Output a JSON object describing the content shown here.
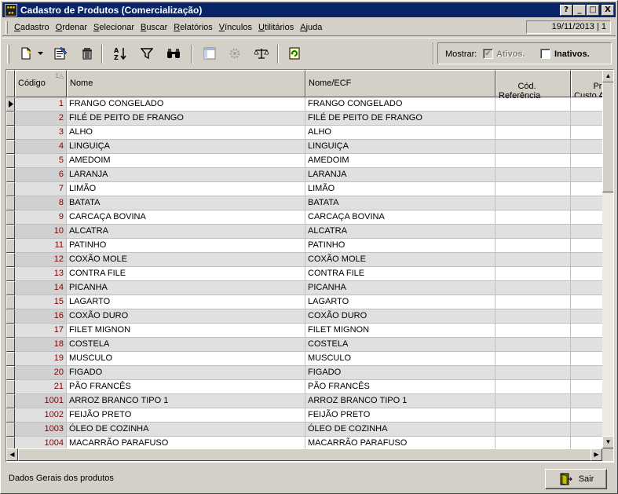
{
  "window": {
    "title": "Cadastro de Produtos (Comercialização)",
    "icon_name": "app-icon",
    "buttons": [
      "?",
      "_",
      "□",
      "X"
    ]
  },
  "menu": {
    "items": [
      {
        "label": "Cadastro",
        "hotkey": "C",
        "rest": "adastro"
      },
      {
        "label": "Ordenar",
        "hotkey": "O",
        "rest": "rdenar"
      },
      {
        "label": "Selecionar",
        "hotkey": "S",
        "rest": "elecionar"
      },
      {
        "label": "Buscar",
        "hotkey": "B",
        "rest": "uscar"
      },
      {
        "label": "Relatórios",
        "hotkey": "R",
        "rest": "elatórios"
      },
      {
        "label": "Vínculos",
        "hotkey": "V",
        "rest": "ínculos"
      },
      {
        "label": "Utilitários",
        "hotkey": "U",
        "rest": "tilitários"
      },
      {
        "label": "Ajuda",
        "hotkey": "A",
        "rest": "juda"
      }
    ],
    "date": "19/11/2013 | 1"
  },
  "toolbar": {
    "icons": [
      "new-record-icon",
      "dropdown-arrow-icon",
      "edit-record-icon",
      "delete-icon",
      "sort-az-icon",
      "filter-icon",
      "binoculars-icon",
      "layout-icon",
      "gear-icon",
      "balance-icon",
      "refresh-icon"
    ],
    "mostrar_label": "Mostrar:",
    "ativos_label": "Ativos.",
    "ativos_checked": true,
    "ativos_disabled": true,
    "inativos_label": "Inativos.",
    "inativos_checked": false
  },
  "grid": {
    "columns": [
      {
        "label": "Código",
        "sort_indicator": "1△"
      },
      {
        "label": "Nome"
      },
      {
        "label": "Nome/ECF"
      },
      {
        "label": "Cód.\nReferência"
      },
      {
        "label": "Preço d\nCusto A"
      }
    ],
    "rows": [
      {
        "codigo": "1",
        "nome": "FRANGO CONGELADO",
        "ecf": "FRANGO CONGELADO"
      },
      {
        "codigo": "2",
        "nome": "FILÉ DE PEITO DE FRANGO",
        "ecf": "FILÉ DE PEITO DE FRANGO"
      },
      {
        "codigo": "3",
        "nome": "ALHO",
        "ecf": "ALHO"
      },
      {
        "codigo": "4",
        "nome": "LINGUIÇA",
        "ecf": "LINGUIÇA"
      },
      {
        "codigo": "5",
        "nome": "AMEDOIM",
        "ecf": "AMEDOIM"
      },
      {
        "codigo": "6",
        "nome": "LARANJA",
        "ecf": "LARANJA"
      },
      {
        "codigo": "7",
        "nome": "LIMÃO",
        "ecf": "LIMÃO"
      },
      {
        "codigo": "8",
        "nome": "BATATA",
        "ecf": "BATATA"
      },
      {
        "codigo": "9",
        "nome": "CARCAÇA BOVINA",
        "ecf": "CARCAÇA BOVINA"
      },
      {
        "codigo": "10",
        "nome": "ALCATRA",
        "ecf": "ALCATRA"
      },
      {
        "codigo": "11",
        "nome": "PATINHO",
        "ecf": "PATINHO"
      },
      {
        "codigo": "12",
        "nome": "COXÃO MOLE",
        "ecf": "COXÃO MOLE"
      },
      {
        "codigo": "13",
        "nome": "CONTRA FILE",
        "ecf": "CONTRA FILE"
      },
      {
        "codigo": "14",
        "nome": "PICANHA",
        "ecf": "PICANHA"
      },
      {
        "codigo": "15",
        "nome": "LAGARTO",
        "ecf": "LAGARTO"
      },
      {
        "codigo": "16",
        "nome": "COXÃO DURO",
        "ecf": "COXÃO DURO"
      },
      {
        "codigo": "17",
        "nome": "FILET MIGNON",
        "ecf": "FILET MIGNON"
      },
      {
        "codigo": "18",
        "nome": "COSTELA",
        "ecf": "COSTELA"
      },
      {
        "codigo": "19",
        "nome": "MUSCULO",
        "ecf": "MUSCULO"
      },
      {
        "codigo": "20",
        "nome": "FIGADO",
        "ecf": "FIGADO"
      },
      {
        "codigo": "21",
        "nome": "PÃO FRANCÊS",
        "ecf": "PÃO FRANCÊS"
      },
      {
        "codigo": "1001",
        "nome": "ARROZ BRANCO TIPO 1",
        "ecf": "ARROZ BRANCO TIPO 1"
      },
      {
        "codigo": "1002",
        "nome": "FEIJÃO PRETO",
        "ecf": "FEIJÃO PRETO"
      },
      {
        "codigo": "1003",
        "nome": "ÓLEO DE COZINHA",
        "ecf": "ÓLEO DE COZINHA"
      },
      {
        "codigo": "1004",
        "nome": "MACARRÃO PARAFUSO",
        "ecf": "MACARRÃO PARAFUSO"
      }
    ],
    "selected_row": 0
  },
  "status": {
    "text": "Dados Gerais dos produtos",
    "sair_label": "Sair"
  },
  "colors": {
    "titlebar": "#0a246a",
    "codigo_text": "#800000",
    "face": "#d4d0c8"
  }
}
